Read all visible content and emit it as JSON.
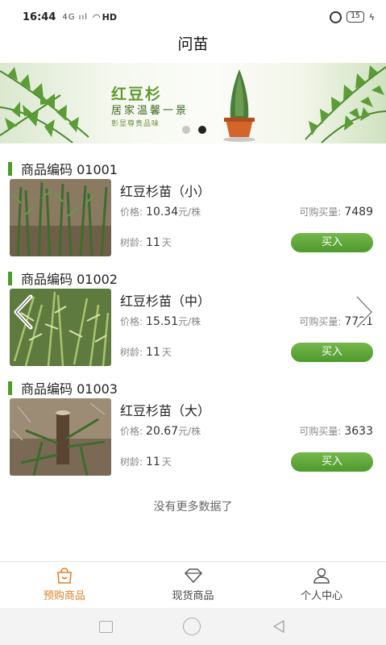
{
  "status_bar": {
    "time": "16:44",
    "signal": "4G ııl",
    "wifi": "◠",
    "network": "HD",
    "battery": "15"
  },
  "header": {
    "title": "问苗"
  },
  "banner": {
    "title": "红豆杉",
    "line2": "居家温馨一景",
    "line3": "彰显尊贵品味",
    "active_dot": 1,
    "dot_count": 2
  },
  "labels": {
    "price": "价格:",
    "price_unit": "元/株",
    "stock": "可购买量:",
    "age": "树龄:",
    "age_unit": "天",
    "buy": "买入"
  },
  "products": [
    {
      "code": "商品编码 01001",
      "name": "红豆杉苗（小）",
      "price": "10.34",
      "stock": "7489",
      "age": "11"
    },
    {
      "code": "商品编码 01002",
      "name": "红豆杉苗（中）",
      "price": "15.51",
      "stock": "7721",
      "age": "11"
    },
    {
      "code": "商品编码 01003",
      "name": "红豆杉苗（大）",
      "price": "20.67",
      "stock": "3633",
      "age": "11"
    }
  ],
  "footer_note": "没有更多数据了",
  "tabs": [
    {
      "label": "预购商品",
      "icon": "bag-icon",
      "active": true
    },
    {
      "label": "现货商品",
      "icon": "diamond-icon",
      "active": false
    },
    {
      "label": "个人中心",
      "icon": "person-icon",
      "active": false
    }
  ],
  "colors": {
    "accent_green": "#4e9a2c",
    "active_tab": "#e0822a"
  }
}
